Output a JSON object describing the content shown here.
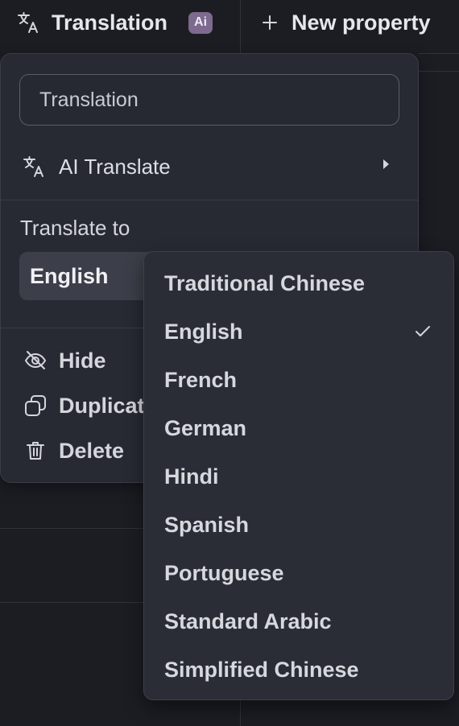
{
  "header": {
    "column_title": "Translation",
    "ai_badge": "Ai",
    "new_property_label": "New property"
  },
  "panel": {
    "name_input_value": "Translation",
    "ai_translate_label": "AI Translate",
    "translate_to_label": "Translate to",
    "selected_language": "English",
    "actions": {
      "hide": "Hide",
      "duplicate": "Duplicate",
      "delete": "Delete"
    }
  },
  "dropdown": {
    "options": [
      "Traditional Chinese",
      "English",
      "French",
      "German",
      "Hindi",
      "Spanish",
      "Portuguese",
      "Standard Arabic",
      "Simplified Chinese"
    ],
    "selected": "English"
  },
  "colors": {
    "background": "#1b1d23",
    "panel": "#272a33",
    "dropdown": "#2a2d36",
    "ai_badge": "#7d6a8e",
    "text": "#d4d6dc"
  },
  "icons": {
    "translate": "translate-icon",
    "plus": "plus-icon",
    "eye_off": "eye-off-icon",
    "duplicate": "duplicate-icon",
    "trash": "trash-icon",
    "check": "check-icon"
  }
}
